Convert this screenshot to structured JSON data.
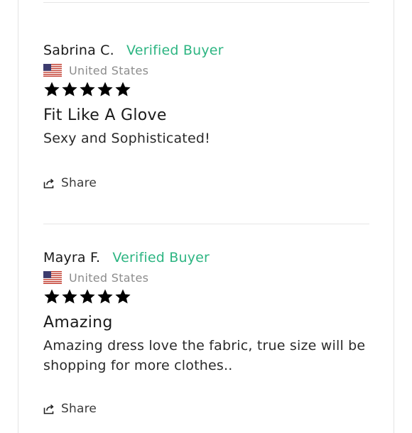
{
  "reviews": [
    {
      "author": "Sabrina C.",
      "badge": "Verified Buyer",
      "country": "United States",
      "flag_icon": "us-flag-icon",
      "rating": 5,
      "title": "Fit Like A Glove",
      "body": "Sexy and Sophisticated!",
      "share_label": "Share"
    },
    {
      "author": "Mayra F.",
      "badge": "Verified Buyer",
      "country": "United States",
      "flag_icon": "us-flag-icon",
      "rating": 5,
      "title": "Amazing",
      "body_lines": [
        "Amazing dress love the fabric, true size will be",
        "shopping for more clothes.."
      ],
      "share_label": "Share"
    }
  ],
  "colors": {
    "verified": "#2db582",
    "star": "#000000",
    "divider": "#e6e6e6"
  }
}
